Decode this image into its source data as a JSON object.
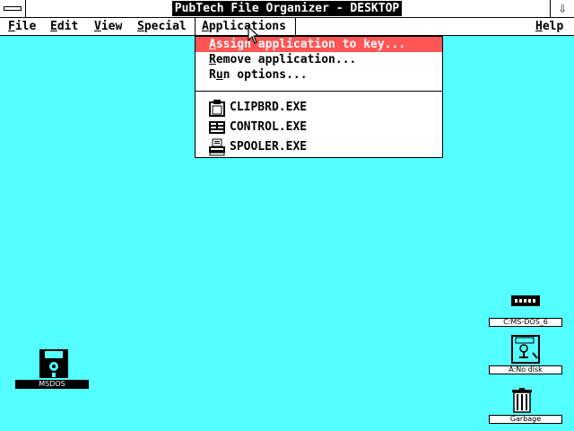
{
  "window": {
    "title": "PubTech File Organizer - DESKTOP",
    "sizebox_glyph": "⇩"
  },
  "menubar": {
    "items": [
      {
        "label_key": "F",
        "label_rest": "ile"
      },
      {
        "label_key": "E",
        "label_rest": "dit"
      },
      {
        "label_key": "V",
        "label_rest": "iew"
      },
      {
        "label_key": "S",
        "label_rest": "pecial"
      },
      {
        "label_key": "A",
        "label_rest": "pplications"
      }
    ],
    "help": {
      "label_key": "H",
      "label_rest": "elp"
    }
  },
  "dropdown": {
    "commands": [
      {
        "label_key": "A",
        "label_rest": "ssign application to key...",
        "highlighted": true
      },
      {
        "label_key": "R",
        "label_rest": "emove application...",
        "highlighted": false
      },
      {
        "label_key": "R",
        "label_rest": "un options...",
        "mnemonic_index": 1,
        "highlighted": false
      }
    ],
    "run_options_pre": "R",
    "run_options_key": "u",
    "run_options_post": "n options...",
    "apps": [
      {
        "name": "CLIPBRD.EXE",
        "icon": "clipboard-icon"
      },
      {
        "name": "CONTROL.EXE",
        "icon": "control-panel-icon"
      },
      {
        "name": "SPOOLER.EXE",
        "icon": "printer-icon"
      }
    ]
  },
  "desktop": {
    "icons": [
      {
        "label": "MSDOS",
        "icon": "floppy-disk-icon",
        "selected": true
      },
      {
        "label": "C:MS-DOS_6",
        "icon": "hard-drive-icon",
        "selected": false
      },
      {
        "label": "A:No disk",
        "icon": "floppy-drive-icon",
        "selected": false
      },
      {
        "label": "Garbage",
        "icon": "trash-can-icon",
        "selected": false
      }
    ]
  },
  "colors": {
    "desktop_bg": "#55ffff",
    "highlight": "#ff5555",
    "title_bg": "#000000"
  }
}
